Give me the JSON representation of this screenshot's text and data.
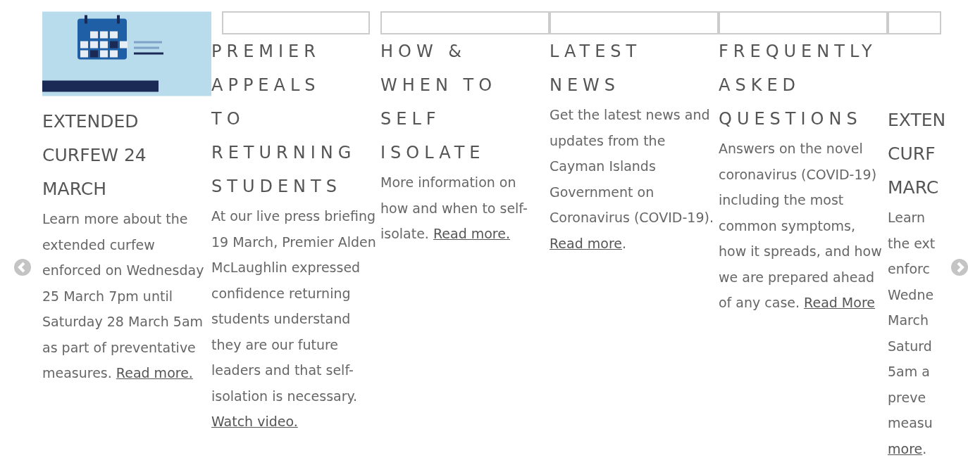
{
  "carousel": {
    "cards": [
      {
        "kind": "feature",
        "title": "EXTENDED CURFEW 24 MARCH",
        "text": "Learn more about the extended curfew enforced on Wednesday 25 March 7pm until Saturday 28 March 5am as part of preventative measures. ",
        "link": "Read more."
      },
      {
        "kind": "inset",
        "title": "PREMIER APPEALS TO RETURNING STUDENTS",
        "text": "At our live press briefing 19 March, Premier Alden McLaughlin expressed confidence returning students understand they are our future leaders and that self-isolation is necessary. ",
        "link": "Watch video."
      },
      {
        "kind": "standard",
        "title": "HOW & WHEN TO SELF ISOLATE",
        "text": "More information on how and when to self-isolate. ",
        "link": "Read more."
      },
      {
        "kind": "standard",
        "title": "LATEST NEWS",
        "text": "Get the latest news and updates from the Cayman Islands Government on Coronavirus (COVID-19). ",
        "link": "Read more",
        "after": "."
      },
      {
        "kind": "standard",
        "title": "FREQUENTLY ASKED QUESTIONS",
        "text": "Answers on the novel coronavirus (COVID-19) including the most common symptoms, how it spreads, and how we are prepared ahead of any case. ",
        "link": "Read More"
      },
      {
        "kind": "clipped",
        "title_lines": [
          "EXTEN",
          "CURF",
          "MARC"
        ],
        "text_lines": [
          "Learn",
          "the ext",
          "enforc",
          "Wedne",
          "March",
          "Saturd",
          "5am a",
          "preve",
          "measu"
        ],
        "link": "more",
        "after": "."
      }
    ]
  }
}
